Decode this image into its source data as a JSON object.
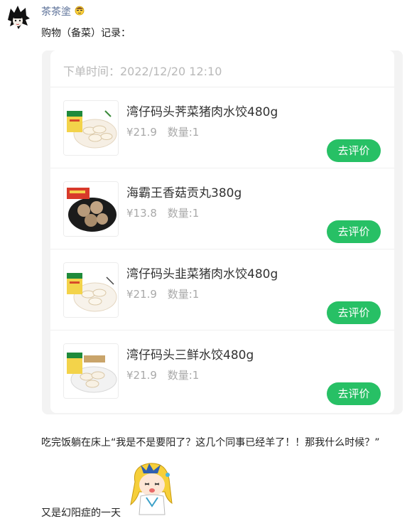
{
  "post": {
    "username": "茶茶塗",
    "intro": "购物（备菜）记录：",
    "caption": "吃完饭躺在床上“我是不是要阳了？这几个同事已经羊了！！那我什么时候？”",
    "caption2": "又是幻阳症的一天"
  },
  "order": {
    "time_label": "下单时间：2022/12/20 12:10",
    "review_label": "去评价",
    "items": [
      {
        "name": "湾仔码头荠菜猪肉水饺480g",
        "price": "¥21.9",
        "qty": "数量:1"
      },
      {
        "name": "海霸王香菇贡丸380g",
        "price": "¥13.8",
        "qty": "数量:1"
      },
      {
        "name": "湾仔码头韭菜猪肉水饺480g",
        "price": "¥21.9",
        "qty": "数量:1"
      },
      {
        "name": "湾仔码头三鲜水饺480g",
        "price": "¥21.9",
        "qty": "数量:1"
      }
    ]
  },
  "colors": {
    "accent_green": "#27c065",
    "username_blue": "#5a6f97"
  },
  "icons": {
    "avatar": "anime-avatar-icon",
    "emoji": "face-emoji-icon",
    "sticker": "anime-girl-sticker"
  }
}
